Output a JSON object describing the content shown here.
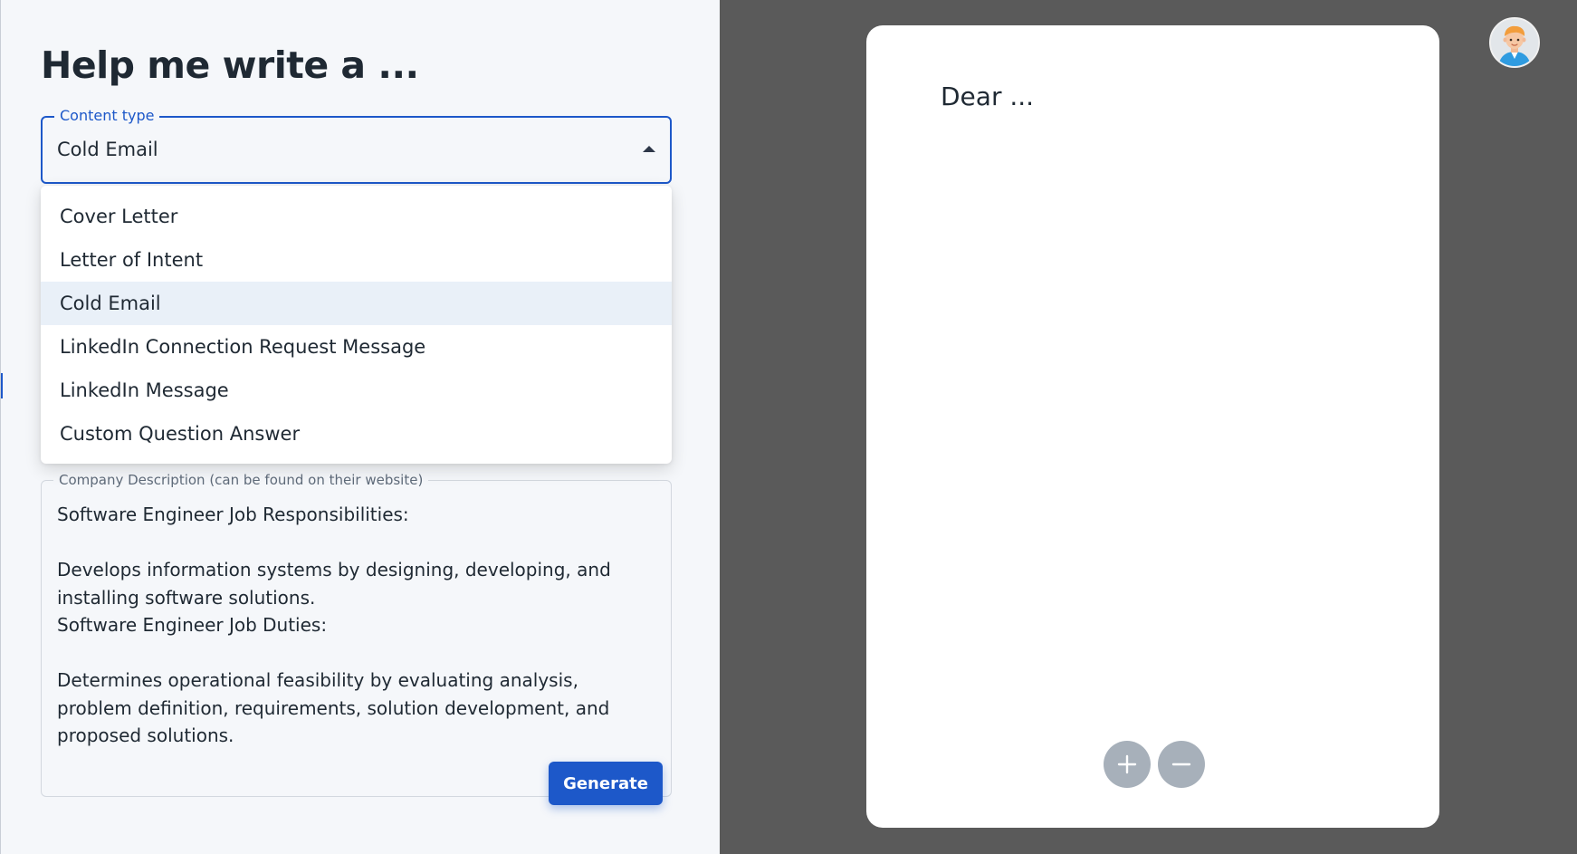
{
  "heading": "Help me write a ...",
  "content_type": {
    "label": "Content type",
    "value": "Cold Email",
    "options": [
      "Cover Letter",
      "Letter of Intent",
      "Cold Email",
      "LinkedIn Connection Request Message",
      "LinkedIn Message",
      "Custom Question Answer"
    ],
    "selected_index": 2
  },
  "company_description": {
    "label": "Company Description (can be found on their website)",
    "value": "Software Engineer Job Responsibilities:\n\nDevelops information systems by designing, developing, and installing software solutions.\nSoftware Engineer Job Duties:\n\nDetermines operational feasibility by evaluating analysis, problem definition, requirements, solution development, and proposed solutions."
  },
  "generate_label": "Generate",
  "preview": {
    "text": "Dear ..."
  },
  "colors": {
    "accent": "#1d58c9",
    "right_background": "#5a5a5a",
    "zoom_button": "#a7b0ba"
  },
  "icons": {
    "zoom_in": "plus-icon",
    "zoom_out": "minus-icon",
    "avatar": "user-avatar-icon",
    "select_caret": "caret-up-icon"
  }
}
